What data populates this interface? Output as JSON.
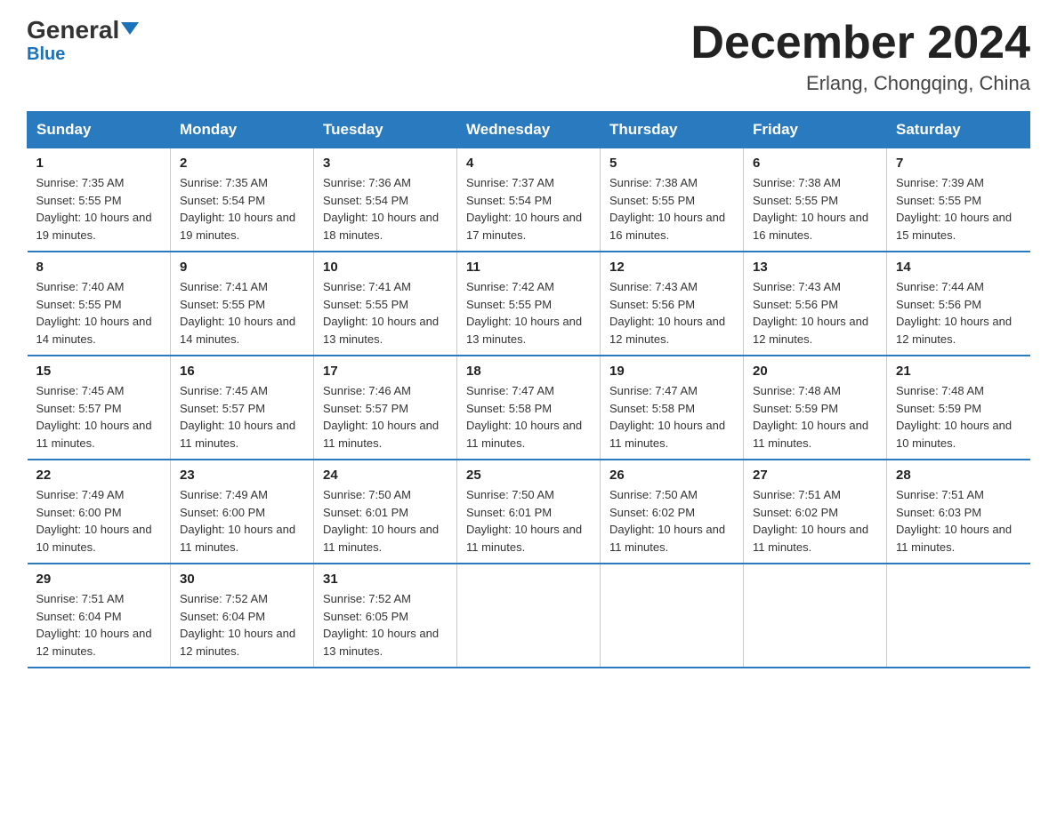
{
  "logo": {
    "general": "General",
    "triangle": "▼",
    "blue": "Blue"
  },
  "header": {
    "month_year": "December 2024",
    "location": "Erlang, Chongqing, China"
  },
  "weekdays": [
    "Sunday",
    "Monday",
    "Tuesday",
    "Wednesday",
    "Thursday",
    "Friday",
    "Saturday"
  ],
  "weeks": [
    [
      {
        "day": "1",
        "sunrise": "7:35 AM",
        "sunset": "5:55 PM",
        "daylight": "10 hours and 19 minutes."
      },
      {
        "day": "2",
        "sunrise": "7:35 AM",
        "sunset": "5:54 PM",
        "daylight": "10 hours and 19 minutes."
      },
      {
        "day": "3",
        "sunrise": "7:36 AM",
        "sunset": "5:54 PM",
        "daylight": "10 hours and 18 minutes."
      },
      {
        "day": "4",
        "sunrise": "7:37 AM",
        "sunset": "5:54 PM",
        "daylight": "10 hours and 17 minutes."
      },
      {
        "day": "5",
        "sunrise": "7:38 AM",
        "sunset": "5:55 PM",
        "daylight": "10 hours and 16 minutes."
      },
      {
        "day": "6",
        "sunrise": "7:38 AM",
        "sunset": "5:55 PM",
        "daylight": "10 hours and 16 minutes."
      },
      {
        "day": "7",
        "sunrise": "7:39 AM",
        "sunset": "5:55 PM",
        "daylight": "10 hours and 15 minutes."
      }
    ],
    [
      {
        "day": "8",
        "sunrise": "7:40 AM",
        "sunset": "5:55 PM",
        "daylight": "10 hours and 14 minutes."
      },
      {
        "day": "9",
        "sunrise": "7:41 AM",
        "sunset": "5:55 PM",
        "daylight": "10 hours and 14 minutes."
      },
      {
        "day": "10",
        "sunrise": "7:41 AM",
        "sunset": "5:55 PM",
        "daylight": "10 hours and 13 minutes."
      },
      {
        "day": "11",
        "sunrise": "7:42 AM",
        "sunset": "5:55 PM",
        "daylight": "10 hours and 13 minutes."
      },
      {
        "day": "12",
        "sunrise": "7:43 AM",
        "sunset": "5:56 PM",
        "daylight": "10 hours and 12 minutes."
      },
      {
        "day": "13",
        "sunrise": "7:43 AM",
        "sunset": "5:56 PM",
        "daylight": "10 hours and 12 minutes."
      },
      {
        "day": "14",
        "sunrise": "7:44 AM",
        "sunset": "5:56 PM",
        "daylight": "10 hours and 12 minutes."
      }
    ],
    [
      {
        "day": "15",
        "sunrise": "7:45 AM",
        "sunset": "5:57 PM",
        "daylight": "10 hours and 11 minutes."
      },
      {
        "day": "16",
        "sunrise": "7:45 AM",
        "sunset": "5:57 PM",
        "daylight": "10 hours and 11 minutes."
      },
      {
        "day": "17",
        "sunrise": "7:46 AM",
        "sunset": "5:57 PM",
        "daylight": "10 hours and 11 minutes."
      },
      {
        "day": "18",
        "sunrise": "7:47 AM",
        "sunset": "5:58 PM",
        "daylight": "10 hours and 11 minutes."
      },
      {
        "day": "19",
        "sunrise": "7:47 AM",
        "sunset": "5:58 PM",
        "daylight": "10 hours and 11 minutes."
      },
      {
        "day": "20",
        "sunrise": "7:48 AM",
        "sunset": "5:59 PM",
        "daylight": "10 hours and 11 minutes."
      },
      {
        "day": "21",
        "sunrise": "7:48 AM",
        "sunset": "5:59 PM",
        "daylight": "10 hours and 10 minutes."
      }
    ],
    [
      {
        "day": "22",
        "sunrise": "7:49 AM",
        "sunset": "6:00 PM",
        "daylight": "10 hours and 10 minutes."
      },
      {
        "day": "23",
        "sunrise": "7:49 AM",
        "sunset": "6:00 PM",
        "daylight": "10 hours and 11 minutes."
      },
      {
        "day": "24",
        "sunrise": "7:50 AM",
        "sunset": "6:01 PM",
        "daylight": "10 hours and 11 minutes."
      },
      {
        "day": "25",
        "sunrise": "7:50 AM",
        "sunset": "6:01 PM",
        "daylight": "10 hours and 11 minutes."
      },
      {
        "day": "26",
        "sunrise": "7:50 AM",
        "sunset": "6:02 PM",
        "daylight": "10 hours and 11 minutes."
      },
      {
        "day": "27",
        "sunrise": "7:51 AM",
        "sunset": "6:02 PM",
        "daylight": "10 hours and 11 minutes."
      },
      {
        "day": "28",
        "sunrise": "7:51 AM",
        "sunset": "6:03 PM",
        "daylight": "10 hours and 11 minutes."
      }
    ],
    [
      {
        "day": "29",
        "sunrise": "7:51 AM",
        "sunset": "6:04 PM",
        "daylight": "10 hours and 12 minutes."
      },
      {
        "day": "30",
        "sunrise": "7:52 AM",
        "sunset": "6:04 PM",
        "daylight": "10 hours and 12 minutes."
      },
      {
        "day": "31",
        "sunrise": "7:52 AM",
        "sunset": "6:05 PM",
        "daylight": "10 hours and 13 minutes."
      },
      null,
      null,
      null,
      null
    ]
  ],
  "labels": {
    "sunrise": "Sunrise:",
    "sunset": "Sunset:",
    "daylight": "Daylight:"
  }
}
